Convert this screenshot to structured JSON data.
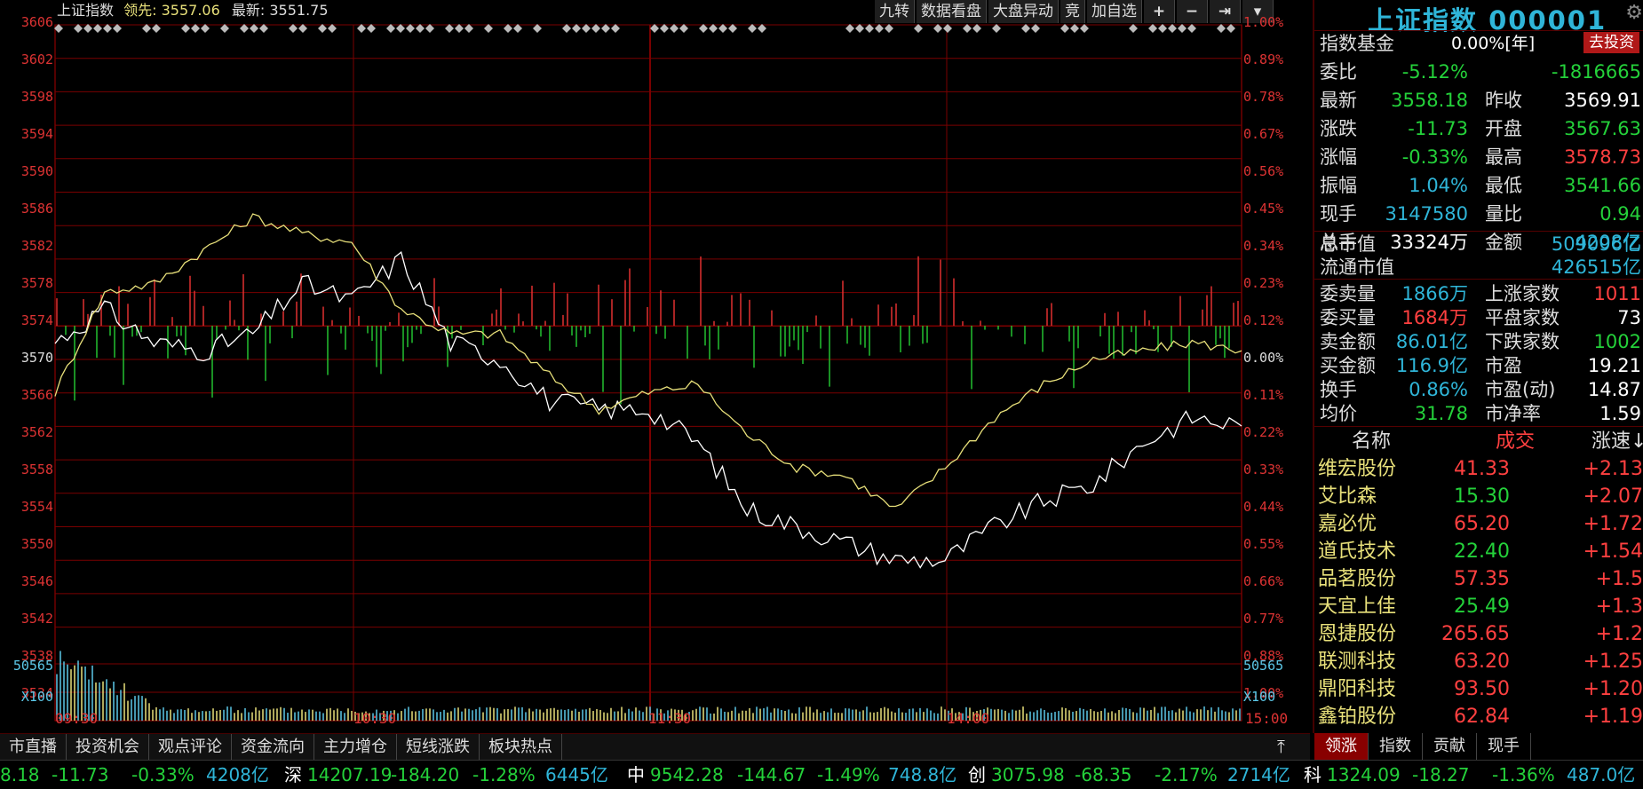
{
  "header": {
    "name": "上证指数",
    "leading_label": "领先:",
    "leading_value": "3557.06",
    "latest_label": "最新:",
    "latest_value": "3551.75"
  },
  "toolbar": {
    "items": [
      "九转",
      "数据看盘",
      "大盘异动",
      "竞",
      "加自选"
    ],
    "icons": [
      "plus-icon",
      "minus-icon",
      "pin-arrow-icon",
      "dropdown-icon"
    ]
  },
  "y_axis": {
    "left_labels": [
      "3606",
      "3602",
      "3598",
      "3594",
      "3590",
      "3586",
      "3582",
      "3578",
      "3574",
      "3570",
      "3566",
      "3562",
      "3558",
      "3554",
      "3550",
      "3546",
      "3542",
      "3538",
      "3534"
    ],
    "right_labels": [
      "1.00%",
      "0.89%",
      "0.78%",
      "0.67%",
      "0.56%",
      "0.45%",
      "0.34%",
      "0.23%",
      "0.12%",
      "0.00%",
      "0.11%",
      "0.22%",
      "0.33%",
      "0.44%",
      "0.55%",
      "0.66%",
      "0.77%",
      "0.88%",
      "1.00%"
    ],
    "volume_left": [
      "50565",
      "X100"
    ],
    "volume_right": [
      "50565",
      "X100"
    ]
  },
  "x_axis": {
    "labels": [
      "09:30",
      "10:30",
      "11:30",
      "14:00",
      "15:00"
    ]
  },
  "chart_data": {
    "type": "line",
    "x": [
      0,
      10,
      20,
      30,
      40,
      50,
      60,
      70,
      80,
      90,
      100,
      110,
      120,
      130,
      140,
      150,
      160,
      170,
      180,
      190,
      200,
      210,
      220,
      230,
      240
    ],
    "series": [
      {
        "values": [
          3568,
          3572,
          3568,
          3567,
          3569,
          3575,
          3573,
          3578,
          3568,
          3566,
          3561,
          3560,
          3560,
          3556,
          3548,
          3546,
          3544,
          3542,
          3542,
          3546,
          3549,
          3551,
          3556,
          3559,
          3558
        ]
      },
      {
        "values": [
          3562,
          3574,
          3575,
          3579,
          3583,
          3581,
          3580,
          3572,
          3569,
          3569,
          3564,
          3560,
          3562,
          3563,
          3557,
          3553,
          3552,
          3548,
          3553,
          3559,
          3563,
          3566,
          3567,
          3568,
          3567
        ]
      }
    ],
    "ylim": [
      3530,
      3606
    ],
    "baseline": 3570
  },
  "panel": {
    "title": "上证指数 000001",
    "fund_label": "指数基金",
    "fund_value": "0.00%[年]",
    "invest_button": "去投资",
    "rows": [
      {
        "l1": "委比",
        "v1": "-5.12%",
        "c1": "vgrn",
        "l2": "",
        "v2": "-1816665",
        "c2": "vgrn"
      },
      {
        "l1": "最新",
        "v1": "3558.18",
        "c1": "vgrn",
        "l2": "昨收",
        "v2": "3569.91",
        "c2": "vwht"
      },
      {
        "l1": "涨跌",
        "v1": "-11.73",
        "c1": "vgrn",
        "l2": "开盘",
        "v2": "3567.63",
        "c2": "vgrn"
      },
      {
        "l1": "涨幅",
        "v1": "-0.33%",
        "c1": "vgrn",
        "l2": "最高",
        "v2": "3578.73",
        "c2": "vred"
      },
      {
        "l1": "振幅",
        "v1": "1.04%",
        "c1": "vcyan",
        "l2": "最低",
        "v2": "3541.66",
        "c2": "vgrn"
      },
      {
        "l1": "现手",
        "v1": "3147580",
        "c1": "vcyan",
        "l2": "量比",
        "v2": "0.94",
        "c2": "vgrn"
      },
      {
        "l1": "总手",
        "v1": "33324万",
        "c1": "vwht",
        "l2": "金额",
        "v2": "4208亿",
        "c2": "vcyan"
      }
    ],
    "market_value": [
      {
        "label": "总市值",
        "value": "509096亿"
      },
      {
        "label": "流通市值",
        "value": "426515亿"
      }
    ],
    "rows2": [
      {
        "l1": "委卖量",
        "v1": "1866万",
        "c1": "vcyan",
        "l2": "上涨家数",
        "v2": "1011",
        "c2": "vred"
      },
      {
        "l1": "委买量",
        "v1": "1684万",
        "c1": "vred",
        "l2": "平盘家数",
        "v2": "73",
        "c2": "vwht"
      },
      {
        "l1": "卖金额",
        "v1": "86.01亿",
        "c1": "vcyan",
        "l2": "下跌家数",
        "v2": "1002",
        "c2": "vgrn"
      },
      {
        "l1": "买金额",
        "v1": "116.9亿",
        "c1": "vcyan",
        "l2": "市盈",
        "v2": "19.21",
        "c2": "vwht"
      },
      {
        "l1": "换手",
        "v1": "0.86%",
        "c1": "vcyan",
        "l2": "市盈(动)",
        "v2": "14.87",
        "c2": "vwht"
      },
      {
        "l1": "均价",
        "v1": "31.78",
        "c1": "vgrn",
        "l2": "市净率",
        "v2": "1.59",
        "c2": "vwht"
      }
    ],
    "list_header": {
      "name": "名称",
      "vol": "成交",
      "speed": "涨速"
    },
    "stocks": [
      {
        "name": "维宏股份",
        "price": "41.33",
        "pc": "vred",
        "chg": "+2.13"
      },
      {
        "name": "艾比森",
        "price": "15.30",
        "pc": "vgrn",
        "chg": "+2.07"
      },
      {
        "name": "嘉必优",
        "price": "65.20",
        "pc": "vred",
        "chg": "+1.72"
      },
      {
        "name": "道氏技术",
        "price": "22.40",
        "pc": "vgrn",
        "chg": "+1.54"
      },
      {
        "name": "品茗股份",
        "price": "57.35",
        "pc": "vred",
        "chg": "+1.5"
      },
      {
        "name": "天宜上佳",
        "price": "25.49",
        "pc": "vgrn",
        "chg": "+1.3"
      },
      {
        "name": "恩捷股份",
        "price": "265.65",
        "pc": "vred",
        "chg": "+1.2"
      },
      {
        "name": "联测科技",
        "price": "63.20",
        "pc": "vred",
        "chg": "+1.25"
      },
      {
        "name": "鼎阳科技",
        "price": "93.50",
        "pc": "vred",
        "chg": "+1.20"
      },
      {
        "name": "鑫铂股份",
        "price": "62.84",
        "pc": "vred",
        "chg": "+1.19"
      }
    ],
    "tabs": [
      "领涨",
      "指数",
      "贡献",
      "现手"
    ]
  },
  "bottom_tabs": [
    "市直播",
    "投资机会",
    "观点评论",
    "资金流向",
    "主力增仓",
    "短线涨跌",
    "板块热点"
  ],
  "ticker": [
    {
      "t": "8.18",
      "c": "vgrn"
    },
    {
      "t": "-11.73",
      "c": "vgrn"
    },
    {
      "t": "-0.33%",
      "c": "vgrn"
    },
    {
      "t": "4208亿",
      "c": "vcyan"
    },
    {
      "t": "深",
      "c": "vwht"
    },
    {
      "t": "14207.19",
      "c": "vgrn"
    },
    {
      "t": "-184.20",
      "c": "vgrn"
    },
    {
      "t": "-1.28%",
      "c": "vgrn"
    },
    {
      "t": "6445亿",
      "c": "vcyan"
    },
    {
      "t": "中",
      "c": "vwht"
    },
    {
      "t": "9542.28",
      "c": "vgrn"
    },
    {
      "t": "-144.67",
      "c": "vgrn"
    },
    {
      "t": "-1.49%",
      "c": "vgrn"
    },
    {
      "t": "748.8亿",
      "c": "vcyan"
    },
    {
      "t": "创",
      "c": "vwht"
    },
    {
      "t": "3075.98",
      "c": "vgrn"
    },
    {
      "t": "-68.35",
      "c": "vgrn"
    },
    {
      "t": "-2.17%",
      "c": "vgrn"
    },
    {
      "t": "2714亿",
      "c": "vcyan"
    },
    {
      "t": "科",
      "c": "vwht"
    },
    {
      "t": "1324.09",
      "c": "vgrn"
    },
    {
      "t": "-18.27",
      "c": "vgrn"
    },
    {
      "t": "-1.36%",
      "c": "vgrn"
    },
    {
      "t": "487.0亿",
      "c": "vcyan"
    }
  ]
}
